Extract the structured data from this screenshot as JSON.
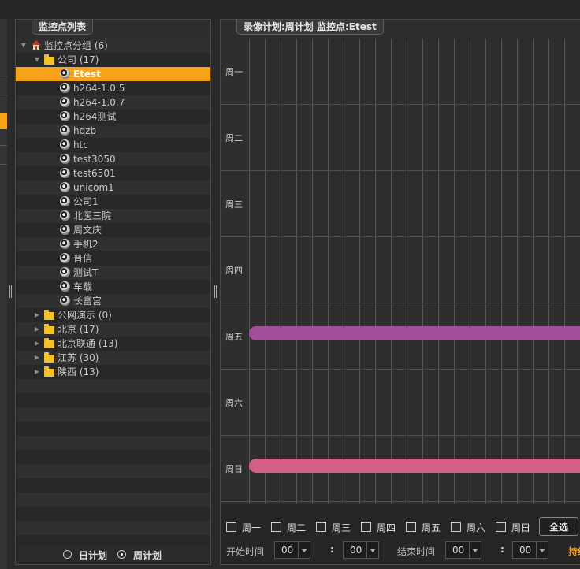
{
  "tree_panel": {
    "tab_title": "监控点列表",
    "nodes": [
      {
        "label": "监控点分组 (6)",
        "icon": "house-icon",
        "arrow": "▼",
        "depth": 0
      },
      {
        "label": "公司 (17)",
        "icon": "folder-open-icon",
        "arrow": "▼",
        "depth": 1
      },
      {
        "label": "Etest",
        "icon": "camera-icon",
        "depth": 3,
        "selected": true
      },
      {
        "label": "h264-1.0.5",
        "icon": "camera-icon",
        "depth": 3
      },
      {
        "label": "h264-1.0.7",
        "icon": "camera-icon",
        "depth": 3
      },
      {
        "label": "h264测试",
        "icon": "camera-icon",
        "depth": 3
      },
      {
        "label": "hqzb",
        "icon": "camera-icon",
        "depth": 3
      },
      {
        "label": "htc",
        "icon": "camera-icon",
        "depth": 3
      },
      {
        "label": "test3050",
        "icon": "camera-icon",
        "depth": 3
      },
      {
        "label": "test6501",
        "icon": "camera-icon",
        "depth": 3
      },
      {
        "label": "unicom1",
        "icon": "camera-icon",
        "depth": 3
      },
      {
        "label": "公司1",
        "icon": "camera-icon",
        "depth": 3
      },
      {
        "label": "北医三院",
        "icon": "camera-icon",
        "depth": 3
      },
      {
        "label": "周文庆",
        "icon": "camera-icon",
        "depth": 3
      },
      {
        "label": "手机2",
        "icon": "camera-icon",
        "depth": 3
      },
      {
        "label": "普信",
        "icon": "camera-icon",
        "depth": 3
      },
      {
        "label": "测试T",
        "icon": "camera-icon",
        "depth": 3
      },
      {
        "label": "车载",
        "icon": "camera-icon",
        "depth": 3
      },
      {
        "label": "长富宫",
        "icon": "camera-icon",
        "depth": 3
      },
      {
        "label": "公网演示 (0)",
        "icon": "folder-icon",
        "arrow": "▶",
        "depth": 1
      },
      {
        "label": "北京 (17)",
        "icon": "folder-icon",
        "arrow": "▶",
        "depth": 1
      },
      {
        "label": "北京联通 (13)",
        "icon": "folder-icon",
        "arrow": "▶",
        "depth": 1
      },
      {
        "label": "江苏 (30)",
        "icon": "folder-icon",
        "arrow": "▶",
        "depth": 1
      },
      {
        "label": "陕西 (13)",
        "icon": "folder-icon",
        "arrow": "▶",
        "depth": 1
      }
    ],
    "plan_options": [
      {
        "label": "日计划",
        "checked": false
      },
      {
        "label": "周计划",
        "checked": true
      }
    ]
  },
  "schedule_panel": {
    "tab_title": "录像计划:周计划 监控点:Etest",
    "days": [
      "周一",
      "周二",
      "周三",
      "周四",
      "周五",
      "周六",
      "周日"
    ],
    "recordings": [
      {
        "day": "周五",
        "color": "#a24f9a"
      },
      {
        "day": "周日",
        "color": "#d35f85"
      }
    ],
    "day_checkboxes": [
      "周一",
      "周二",
      "周三",
      "周四",
      "周五",
      "周六",
      "周日"
    ],
    "select_all_label": "全选",
    "start_label": "开始时间",
    "end_label": "结束时间",
    "start_hour": "00",
    "start_minute": "00",
    "end_hour": "00",
    "end_minute": "00",
    "colon": ":",
    "duration_label_partial": "持续"
  },
  "colors": {
    "accent": "#f7a21b",
    "background": "#2a2a2a"
  }
}
